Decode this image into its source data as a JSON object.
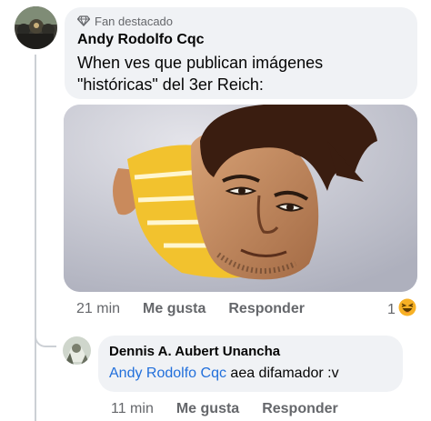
{
  "comment": {
    "badge": "Fan destacado",
    "author": "Andy Rodolfo Cqc",
    "text_line1": "When ves que publican imágenes",
    "text_line2": "\"históricas\" del 3er Reich:",
    "time": "21 min",
    "like_label": "Me gusta",
    "reply_label": "Responder",
    "reaction_count": "1"
  },
  "reply": {
    "author": "Dennis A. Aubert Unancha",
    "mention": "Andy Rodolfo Cqc",
    "text": " aea difamador :v",
    "time": "11 min",
    "like_label": "Me gusta",
    "reply_label": "Responder"
  },
  "colors": {
    "bubble_bg": "#f0f2f5",
    "mention": "#216fdb",
    "meta_text": "#65676b"
  },
  "icons": [
    "diamond-badge-icon",
    "haha-reaction-icon"
  ]
}
